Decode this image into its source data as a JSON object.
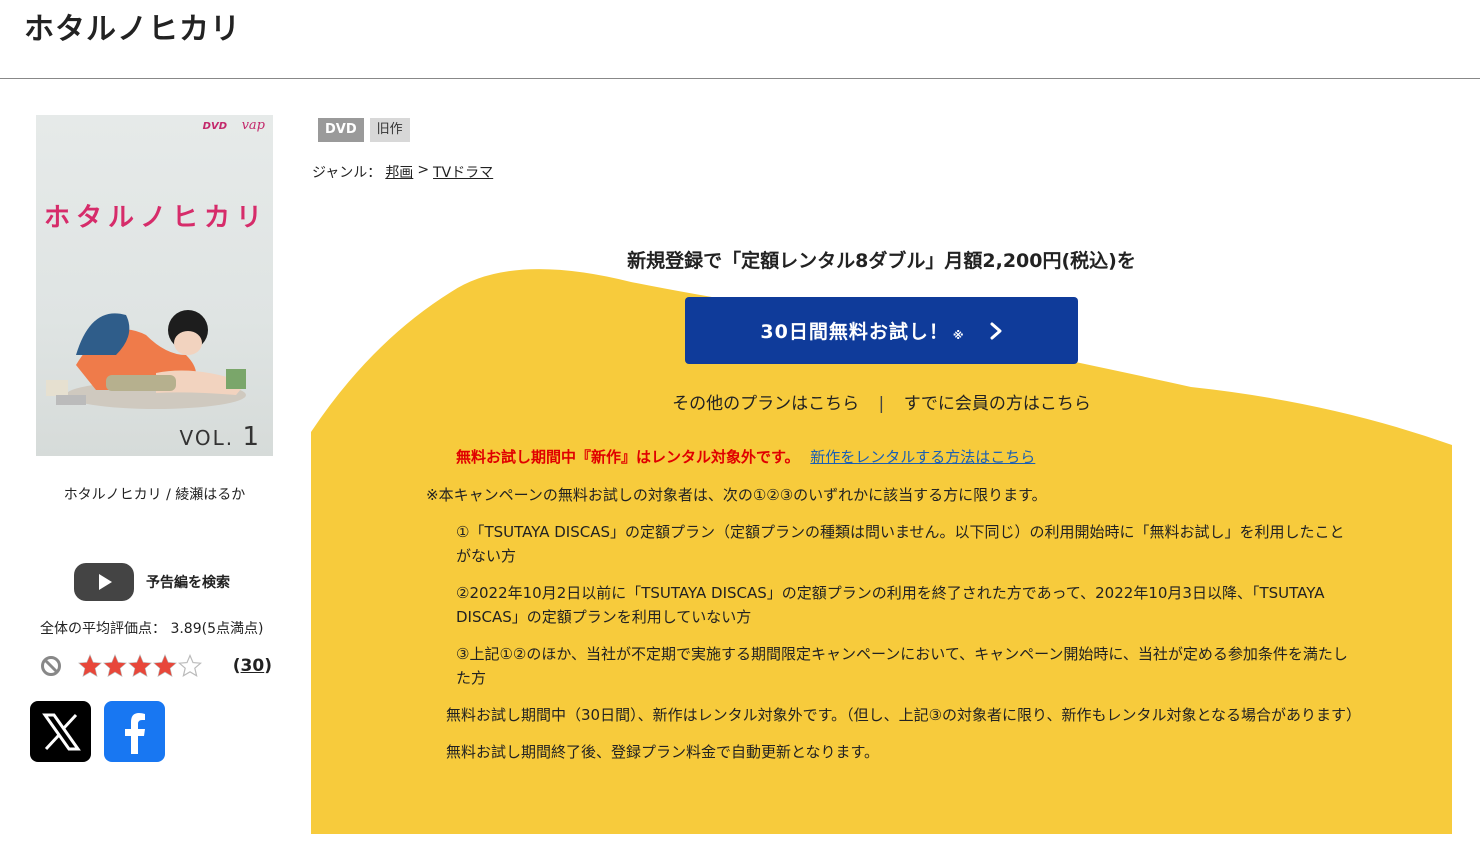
{
  "page": {
    "title": "ホタルノヒカリ"
  },
  "cover": {
    "logo_dvd": "DVD",
    "logo_vap": "vap",
    "title": "ホタルノヒカリ",
    "vol_label": "VOL.",
    "vol_number": "1"
  },
  "item": {
    "caption": "ホタルノヒカリ / 綾瀬はるか",
    "trailer_label": "予告編を検索",
    "avg_rating_text": "全体の平均評価点： 3.89(5点満点)",
    "rating": 3.89,
    "review_count_open": "(",
    "review_count": "30",
    "review_count_close": ")"
  },
  "tags": [
    "DVD",
    "旧作"
  ],
  "genre": {
    "label": "ジャンル：",
    "level1": "邦画",
    "separator": ">",
    "level2": "TVドラマ"
  },
  "promo": {
    "heading": "新規登録で「定額レンタル8ダブル」月額2,200円(税込)を",
    "button_label": "30日間無料お試し！",
    "button_note": "※",
    "other_plans": "その他のプランはこちら",
    "separator": "|",
    "member_link": "すでに会員の方はこちら",
    "warning": "無料お試し期間中『新作』はレンタル対象外です。",
    "warning_link": "新作をレンタルする方法はこちら",
    "terms_lead": "※本キャンペーンの無料お試しの対象者は、次の①②③のいずれかに該当する方に限ります。",
    "cond1": "①「TSUTAYA DISCAS」の定額プラン（定額プランの種類は問いません。以下同じ）の利用開始時に「無料お試し」を利用したことがない方",
    "cond2": "②2022年10月2日以前に「TSUTAYA DISCAS」の定額プランの利用を終了された方であって、2022年10月3日以降、「TSUTAYA DISCAS」の定額プランを利用していない方",
    "cond3": "③上記①②のほか、当社が不定期で実施する期間限定キャンペーンにおいて、キャンペーン開始時に、当社が定める参加条件を満たした方",
    "note1": "無料お試し期間中（30日間）、新作はレンタル対象外です。（但し、上記③の対象者に限り、新作もレンタル対象となる場合があります）",
    "note2": "無料お試し期間終了後、登録プラン料金で自動更新となります。"
  },
  "colors": {
    "promo_bg": "#f7cb3c",
    "button_bg": "#0f3b9a",
    "star_fill": "#e8473a",
    "warning_red": "#e00000",
    "link_blue": "#1a5fb4"
  },
  "icons": {
    "trailer": "play-icon",
    "no_rating": "prohibited-icon",
    "x": "x-logo-icon",
    "facebook": "facebook-logo-icon",
    "chevron": "chevron-right-icon"
  }
}
